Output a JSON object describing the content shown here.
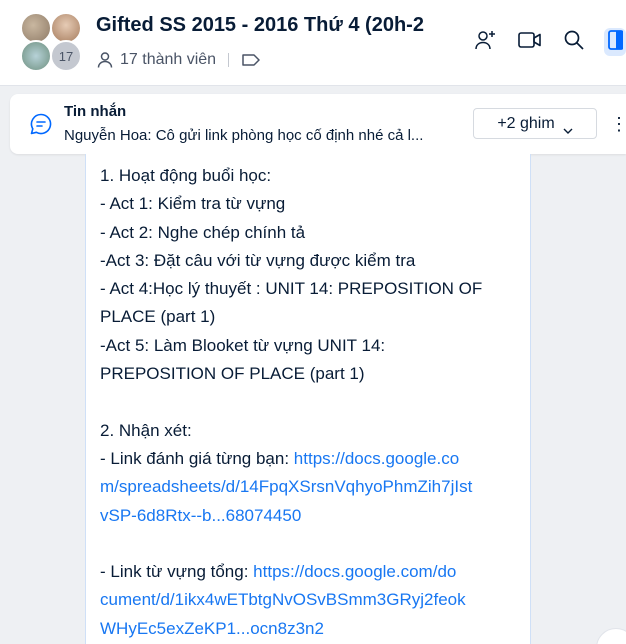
{
  "header": {
    "title": "Gifted SS 2015 - 2016 Thứ 4 (20h-2",
    "avatar_extra_count": "17",
    "member_count": "17 thành viên"
  },
  "pinned": {
    "label": "Tin nhắn",
    "preview": "Nguyễn Hoa: Cô gửi link phòng học cố định nhé cả l...",
    "pin_button": "+2 ghim",
    "more": "⋮"
  },
  "message": {
    "lines": [
      "1. Hoạt động buổi học:",
      "- Act 1: Kiểm tra từ vựng",
      "- Act 2: Nghe chép chính tả",
      "-Act 3: Đặt câu với từ vựng được kiểm tra",
      "- Act 4:Học lý thuyết : UNIT 14: PREPOSITION OF",
      "PLACE (part 1)",
      "-Act 5: Làm Blooket từ vựng UNIT 14:",
      "PREPOSITION OF PLACE (part 1)",
      "2. Nhận xét:"
    ],
    "link1_prefix": "- Link đánh giá từng bạn: ",
    "link1_part1": "https://docs.google.co",
    "link1_part2": "m/spreadsheets/d/14FpqXSrsnVqhyoPhmZih7jIst",
    "link1_part3": "vSP-6d8Rtx--b...68074450",
    "link2_prefix": "- Link từ vựng tổng: ",
    "link2_part1": "https://docs.google.com/do",
    "link2_part2": "cument/d/1ikx4wETbtgNvOSvBSmm3GRyj2feok",
    "link2_part3": "WHyEc5exZeKP1...ocn8z3n2"
  },
  "colors": {
    "link": "#1877f2",
    "accent": "#0068ff",
    "text": "#081c36"
  },
  "icons": [
    "add-member-icon",
    "video-call-icon",
    "search-icon",
    "side-panel-icon",
    "member-icon",
    "tag-icon",
    "chat-bubble-icon",
    "chevron-down-icon"
  ]
}
